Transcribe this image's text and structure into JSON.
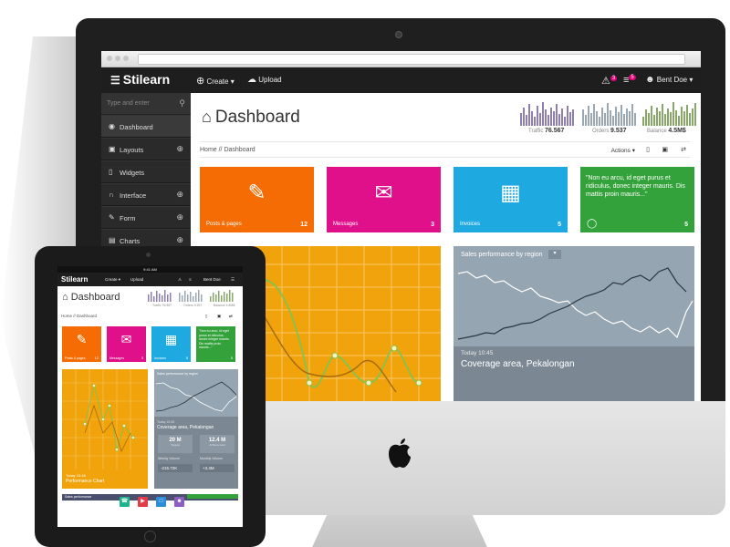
{
  "app": {
    "brand": "Stilearn",
    "create_label": "Create",
    "upload_label": "Upload",
    "user_name": "Bent Doe",
    "alert_badge": "3",
    "settings_badge": "5"
  },
  "sidebar": {
    "search_placeholder": "Type and enter",
    "items": [
      {
        "label": "Dashboard",
        "has_plus": false
      },
      {
        "label": "Layouts",
        "has_plus": true
      },
      {
        "label": "Widgets",
        "has_plus": false
      },
      {
        "label": "Interface",
        "has_plus": true
      },
      {
        "label": "Form",
        "has_plus": true
      },
      {
        "label": "Charts",
        "has_plus": true
      }
    ]
  },
  "header": {
    "title": "Dashboard",
    "breadcrumb": "Home // Dashboard",
    "actions_label": "Actions",
    "stats": [
      {
        "label": "Traffic",
        "value": "76.567"
      },
      {
        "label": "Orders",
        "value": "9.537"
      },
      {
        "label": "Balance",
        "value": "4.5M$"
      }
    ]
  },
  "tiles": [
    {
      "label": "Posts & pages",
      "count": "12",
      "color": "#f46c03",
      "icon": "edit-icon"
    },
    {
      "label": "Messages",
      "count": "3",
      "color": "#e0108a",
      "icon": "envelope-icon"
    },
    {
      "label": "Invoices",
      "count": "5",
      "color": "#1fa9e1",
      "icon": "barcode-icon"
    },
    {
      "label": "\"Non eu arcu, id eget purus et ridiculus, donec integer mauris. Dis mattis proin mauris...\"",
      "count": "5",
      "color": "#33a23a",
      "icon": "comment-icon"
    }
  ],
  "sales_panel": {
    "title": "Sales performance by region",
    "time": "Today 10:45",
    "area": "Coverage area, Pekalongan"
  },
  "ipad": {
    "status_time": "9:41 AM",
    "breadcrumb": "Home // Dashboard",
    "perf_time": "Today 10:45",
    "perf_title": "Performance Chart",
    "sales_title": "Sales performance by region",
    "sales_time": "Today 10:45",
    "sales_area": "Coverage area, Pekalongan",
    "stat1_value": "20 M",
    "stat1_label": "Targets",
    "stat2_value": "12.4 M",
    "stat2_label": "Achievement",
    "weekly_label": "Weekly Volume",
    "weekly_value": "-215.72K",
    "monthly_label": "Monthly Volume",
    "monthly_value": "+3.4M",
    "footer_left": "Sales performance",
    "footer_right": "Server Perfomance"
  }
}
